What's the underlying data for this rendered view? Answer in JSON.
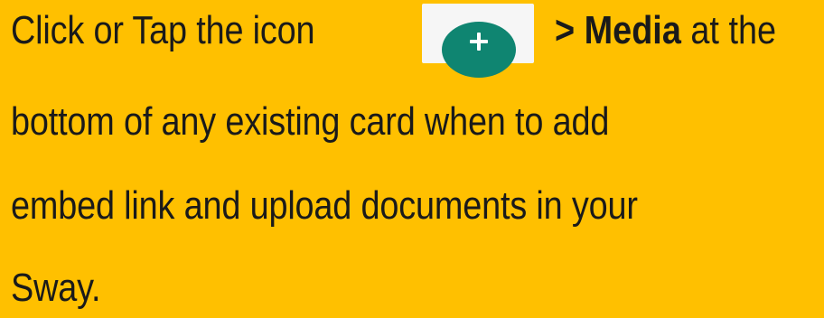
{
  "instruction": {
    "line1_prefix": "Click or Tap the icon",
    "arrow": ">",
    "menu_item": "Media",
    "line1_suffix": "at the",
    "line2": "bottom of any existing card when to add",
    "line3": "embed link and upload documents in your",
    "line4": "Sway."
  },
  "icon": {
    "name": "plus-icon",
    "color": "#0F8571"
  },
  "background_color": "#FFC000"
}
